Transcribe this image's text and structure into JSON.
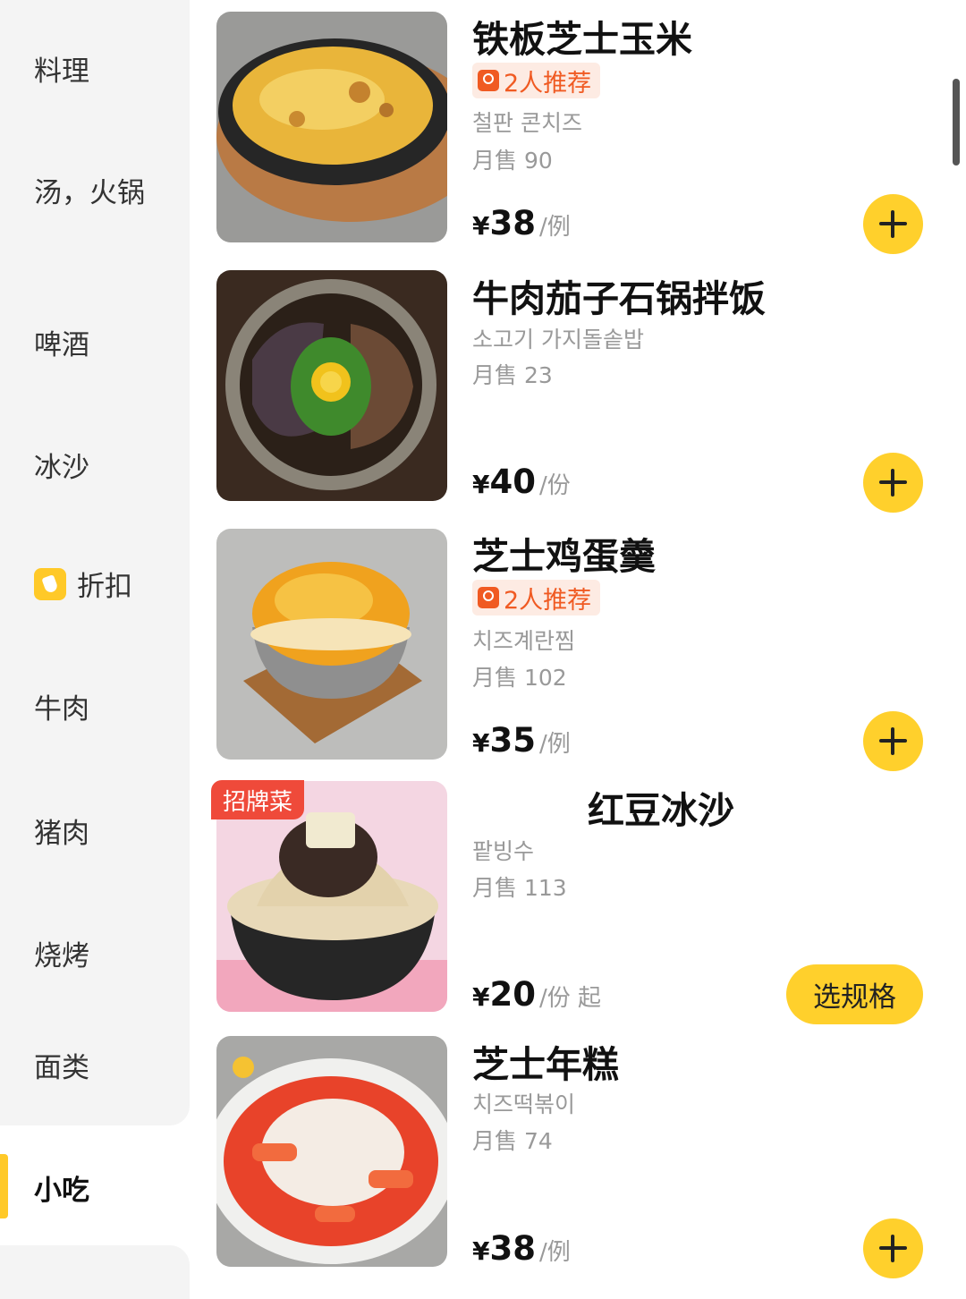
{
  "sidebar": {
    "items": [
      {
        "label": "料理"
      },
      {
        "label": "汤，火锅"
      },
      {
        "label": "啤酒"
      },
      {
        "label": "冰沙"
      },
      {
        "label": "折扣",
        "icon": "tag-icon"
      },
      {
        "label": "牛肉"
      },
      {
        "label": "猪肉"
      },
      {
        "label": "烧烤"
      },
      {
        "label": "面类"
      },
      {
        "label": "小吃",
        "active": true
      }
    ]
  },
  "dishes": [
    {
      "name": "铁板芝士玉米",
      "recommend": "2人推荐",
      "subtitle": "철판 콘치즈",
      "sales": "月售 90",
      "currency": "¥",
      "price": "38",
      "unit": "/例",
      "action": "add"
    },
    {
      "name": "牛肉茄子石锅拌饭",
      "subtitle": "소고기 가지돌솥밥",
      "sales": "月售 23",
      "currency": "¥",
      "price": "40",
      "unit": "/份",
      "action": "add"
    },
    {
      "name": "芝士鸡蛋羹",
      "recommend": "2人推荐",
      "subtitle": "치즈계란찜",
      "sales": "月售 102",
      "currency": "¥",
      "price": "35",
      "unit": "/例",
      "action": "add"
    },
    {
      "name": "红豆冰沙",
      "badge": "招牌菜",
      "subtitle": "팥빙수",
      "sales": "月售 113",
      "currency": "¥",
      "price": "20",
      "unit": "/份 起",
      "action": "选规格"
    },
    {
      "name": "芝士年糕",
      "subtitle": "치즈떡볶이",
      "sales": "月售 74",
      "currency": "¥",
      "price": "38",
      "unit": "/例",
      "action": "add"
    }
  ],
  "colors": {
    "accent": "#ffd02c",
    "recommend": "#f05a22",
    "hot_badge": "#ef4a3a"
  }
}
